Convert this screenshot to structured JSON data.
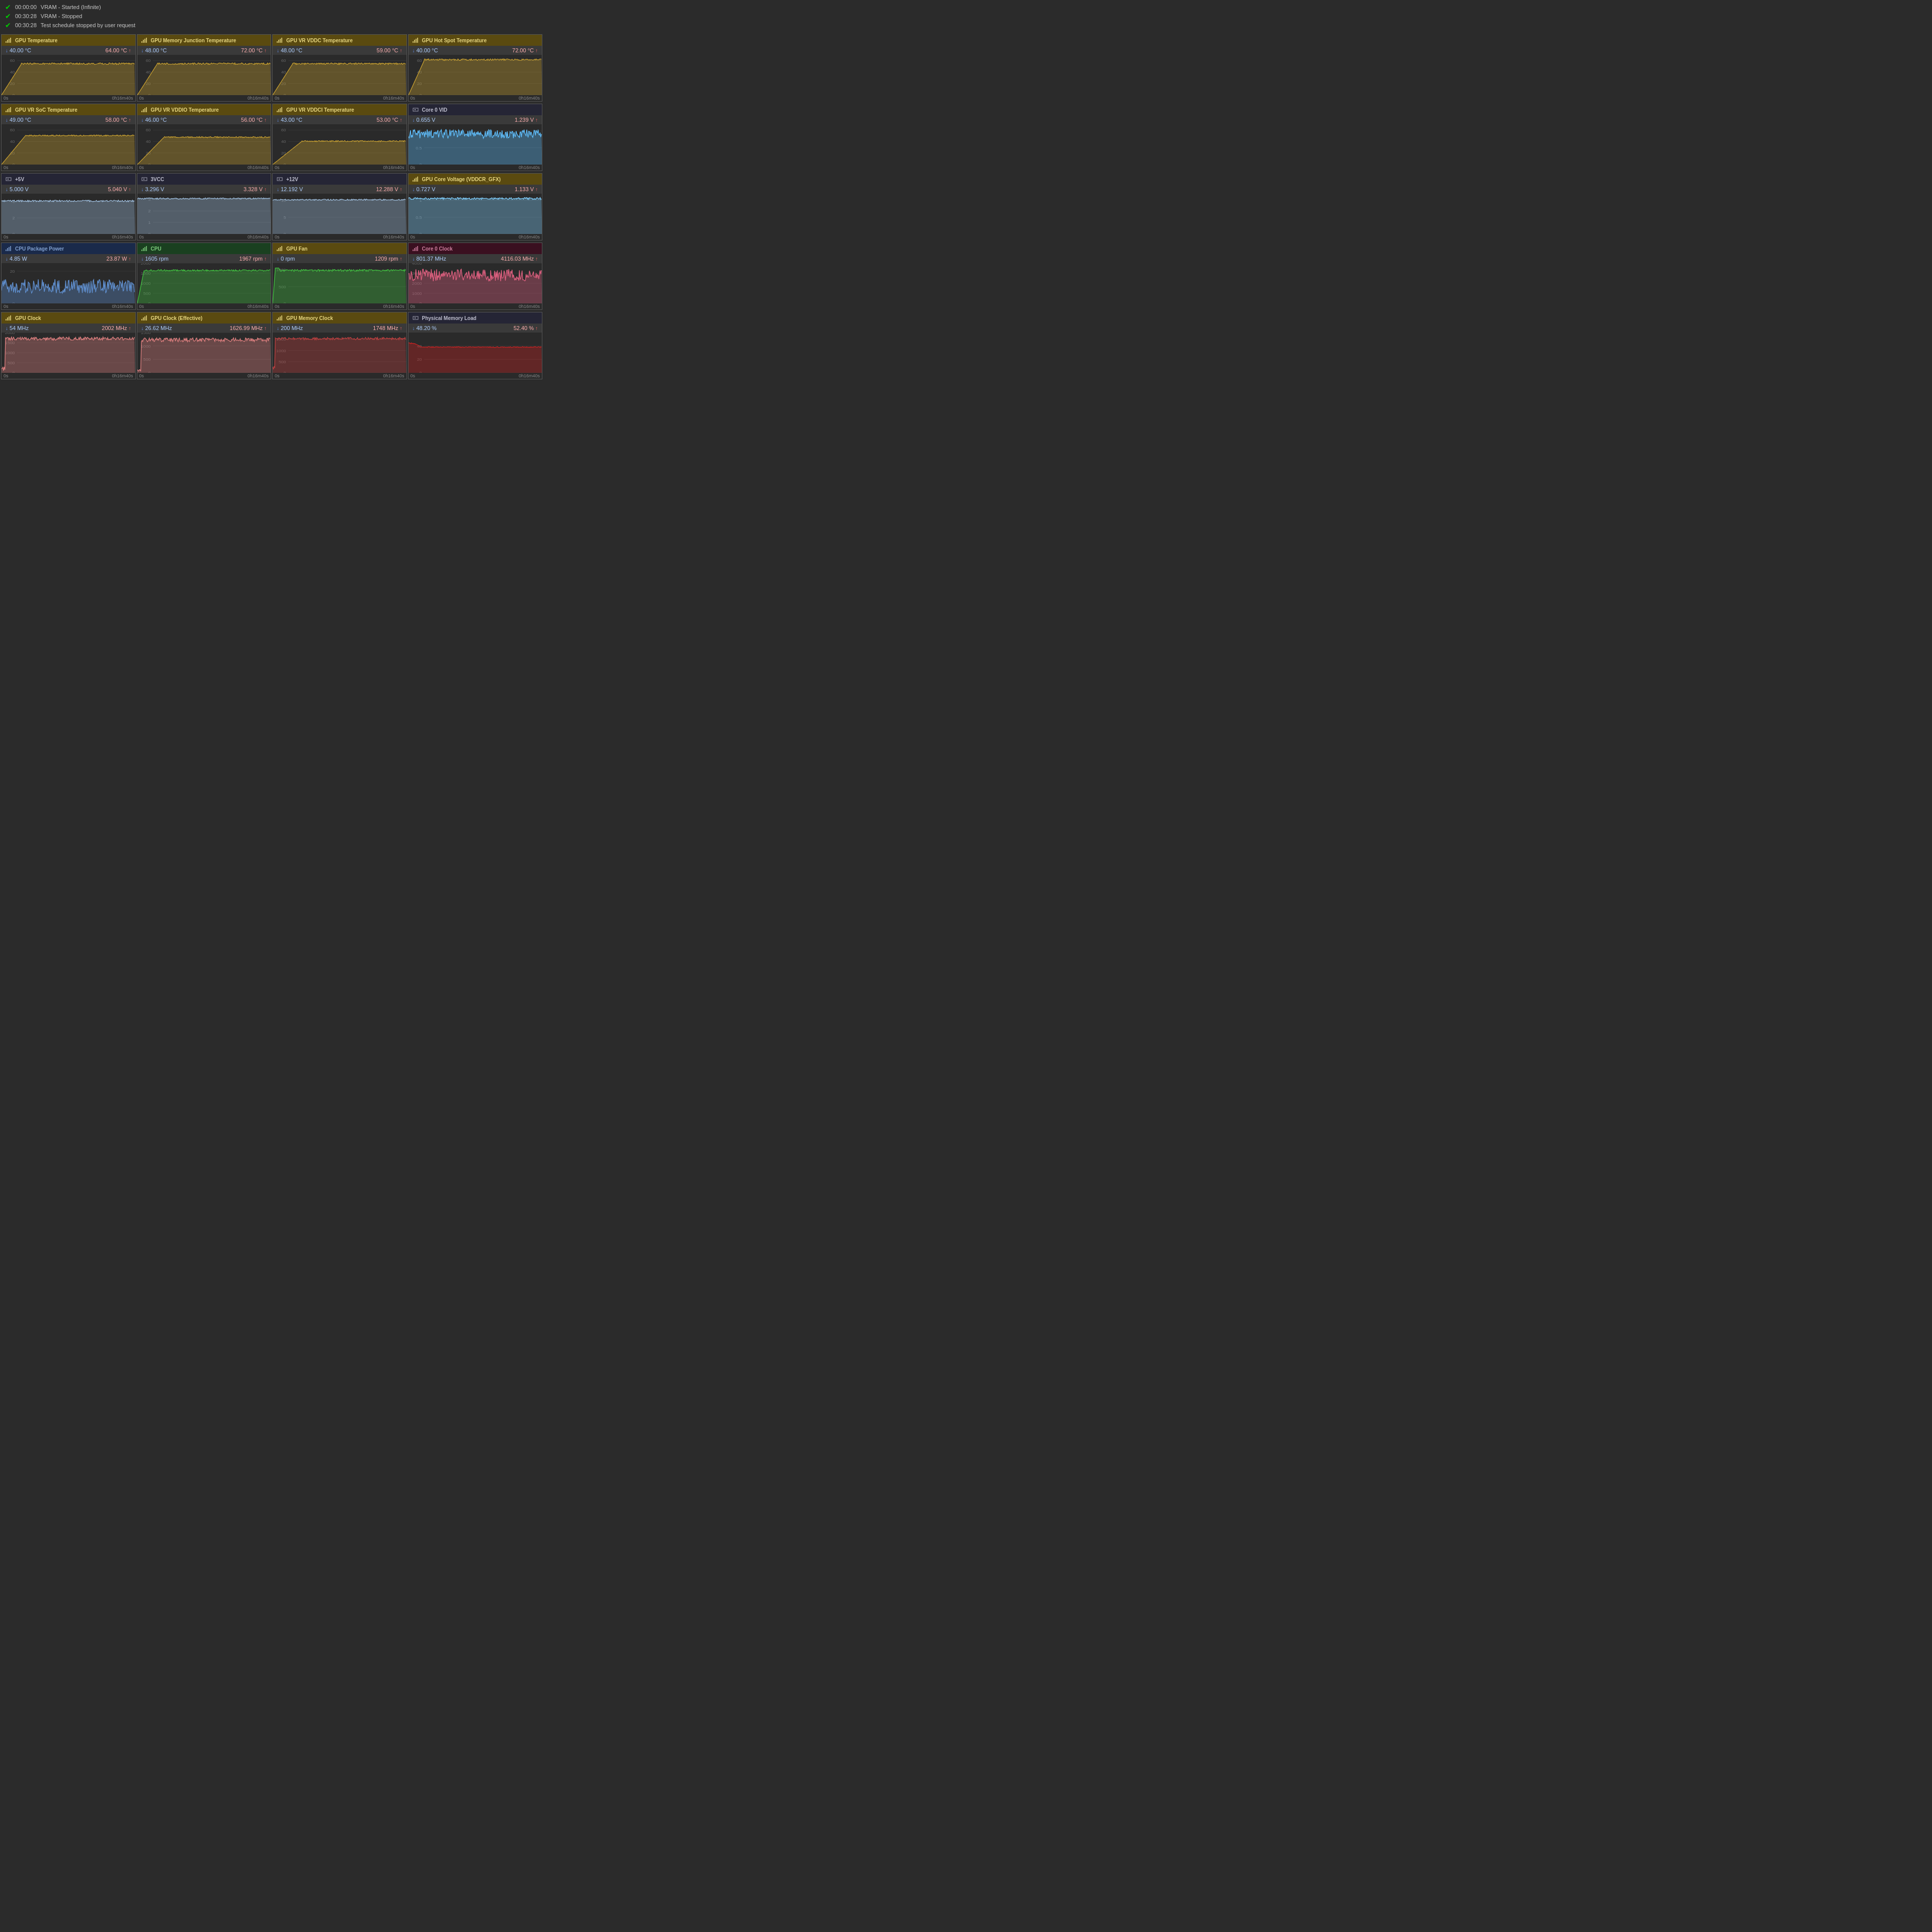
{
  "log": {
    "entries": [
      {
        "time": "00:00:00",
        "text": "VRAM - Started (Infinite)"
      },
      {
        "time": "00:30:28",
        "text": "VRAM - Stopped"
      },
      {
        "time": "00:30:28",
        "text": "Test schedule stopped by user request"
      }
    ]
  },
  "rows": [
    {
      "cards": [
        {
          "title": "GPU Temperature",
          "header_style": "gold",
          "icon": "📊",
          "min": "40.00 °C",
          "max": "64.00 °C",
          "chart_color": "#c8a030",
          "chart_type": "rise_flat",
          "y_max": 70,
          "y_ticks": [
            0,
            20,
            40,
            60
          ]
        },
        {
          "title": "GPU Memory Junction Temperature",
          "header_style": "gold",
          "icon": "📊",
          "min": "48.00 °C",
          "max": "72.00 °C",
          "chart_color": "#c8a030",
          "chart_type": "rise_flat",
          "y_max": 70,
          "y_ticks": [
            0,
            20,
            40,
            60
          ]
        },
        {
          "title": "GPU VR VDDC Temperature",
          "header_style": "gold",
          "icon": "📊",
          "min": "48.00 °C",
          "max": "59.00 °C",
          "chart_color": "#c8a030",
          "chart_type": "rise_flat",
          "y_max": 70,
          "y_ticks": [
            0,
            20,
            40,
            60
          ]
        },
        {
          "title": "GPU Hot Spot Temperature",
          "header_style": "gold",
          "icon": "📊",
          "min": "40.00 °C",
          "max": "72.00 °C",
          "chart_color": "#c8a030",
          "chart_type": "rise_flat_high",
          "y_max": 70,
          "y_ticks": [
            0,
            20,
            40,
            60
          ]
        }
      ]
    },
    {
      "cards": [
        {
          "title": "GPU VR SoC Temperature",
          "header_style": "gold",
          "icon": "📊",
          "min": "49.00 °C",
          "max": "58.00 °C",
          "chart_color": "#c8a030",
          "chart_type": "rise_flat_mid",
          "y_max": 70,
          "y_ticks": [
            0,
            20,
            40,
            60
          ]
        },
        {
          "title": "GPU VR VDDIO Temperature",
          "header_style": "gold",
          "icon": "📊",
          "min": "46.00 °C",
          "max": "56.00 °C",
          "chart_color": "#c8a030",
          "chart_type": "rise_flat_mid2",
          "y_max": 70,
          "y_ticks": [
            0,
            20,
            40,
            60
          ]
        },
        {
          "title": "GPU VR VDDCI Temperature",
          "header_style": "gold",
          "icon": "📊",
          "min": "43.00 °C",
          "max": "53.00 °C",
          "chart_color": "#c8a030",
          "chart_type": "rise_flat_low",
          "y_max": 70,
          "y_ticks": [
            0,
            20,
            40,
            60
          ]
        },
        {
          "title": "Core 0 VID",
          "header_style": "dark",
          "icon": "⬜",
          "min": "0.655 V",
          "max": "1.239 V",
          "chart_color": "#60c0ff",
          "chart_type": "vid_noisy",
          "y_max": 1.2,
          "y_ticks": [
            0,
            0.5,
            1
          ]
        }
      ]
    },
    {
      "cards": [
        {
          "title": "+5V",
          "header_style": "dark",
          "icon": "⬛",
          "min": "5.000 V",
          "max": "5.040 V",
          "chart_color": "#a0c0e0",
          "chart_type": "flat_noisy",
          "y_max": 5,
          "y_ticks": [
            0,
            2,
            4
          ]
        },
        {
          "title": "3VCC",
          "header_style": "dark",
          "icon": "⬛",
          "min": "3.296 V",
          "max": "3.328 V",
          "chart_color": "#a0c0e0",
          "chart_type": "flat_noisy_3v",
          "y_max": 3.5,
          "y_ticks": [
            0,
            1,
            2,
            3
          ]
        },
        {
          "title": "+12V",
          "header_style": "dark",
          "icon": "⬛",
          "min": "12.192 V",
          "max": "12.288 V",
          "chart_color": "#a0c0e0",
          "chart_type": "flat_noisy_12v",
          "y_max": 12,
          "y_ticks": [
            0,
            5,
            10
          ]
        },
        {
          "title": "GPU Core Voltage (VDDCR_GFX)",
          "header_style": "gold",
          "icon": "📊",
          "min": "0.727 V",
          "max": "1.133 V",
          "chart_color": "#80d0ff",
          "chart_type": "flat_top_noisy",
          "y_max": 1.2,
          "y_ticks": [
            0,
            0.5,
            1
          ]
        }
      ]
    },
    {
      "cards": [
        {
          "title": "CPU Package Power",
          "header_style": "blue",
          "icon": "⬜",
          "min": "4.85 W",
          "max": "23.87 W",
          "chart_color": "#6090d0",
          "chart_type": "cpu_power",
          "y_max": 25,
          "y_ticks": [
            0,
            10,
            20
          ]
        },
        {
          "title": "CPU",
          "header_style": "green",
          "icon": "⬛",
          "min": "1605 rpm",
          "max": "1967 rpm",
          "chart_color": "#40c040",
          "chart_type": "cpu_fan",
          "y_max": 2000,
          "y_ticks": [
            0,
            500,
            1000,
            1500,
            2000
          ]
        },
        {
          "title": "GPU Fan",
          "header_style": "gold",
          "icon": "📊",
          "min": "0 rpm",
          "max": "1209 rpm",
          "chart_color": "#40c040",
          "chart_type": "gpu_fan",
          "y_max": 1200,
          "y_ticks": [
            0,
            500,
            1000
          ]
        },
        {
          "title": "Core 0 Clock",
          "header_style": "purple",
          "icon": "⬜",
          "min": "801.37 MHz",
          "max": "4116.03 MHz",
          "chart_color": "#e06080",
          "chart_type": "core_clock",
          "y_max": 4000,
          "y_ticks": [
            0,
            1000,
            2000,
            3000,
            4000
          ]
        }
      ]
    },
    {
      "cards": [
        {
          "title": "GPU Clock",
          "header_style": "gold",
          "icon": "📊",
          "min": "54 MHz",
          "max": "2002 MHz",
          "chart_color": "#e08080",
          "chart_type": "gpu_clock",
          "y_max": 2000,
          "y_ticks": [
            0,
            500,
            1000,
            1500,
            2000
          ]
        },
        {
          "title": "GPU Clock (Effective)",
          "header_style": "gold",
          "icon": "📊",
          "min": "26.62 MHz",
          "max": "1626.99 MHz",
          "chart_color": "#e08080",
          "chart_type": "gpu_clock_eff",
          "y_max": 1500,
          "y_ticks": [
            0,
            500,
            1000,
            1500
          ]
        },
        {
          "title": "GPU Memory Clock",
          "header_style": "gold",
          "icon": "📊",
          "min": "200 MHz",
          "max": "1748 MHz",
          "chart_color": "#c04040",
          "chart_type": "gpu_mem_clock",
          "y_max": 1800,
          "y_ticks": [
            0,
            500,
            1000,
            1500
          ]
        },
        {
          "title": "Physical Memory Load",
          "header_style": "dark",
          "icon": "?",
          "min": "48.20 %",
          "max": "52.40 %",
          "chart_color": "#cc2222",
          "chart_type": "mem_load",
          "y_max": 60,
          "y_ticks": [
            0,
            20,
            40
          ]
        }
      ]
    }
  ],
  "time_label": "0h16m40s",
  "time_start": "0s",
  "colors": {
    "gold_header": "#5a4a10",
    "green_header": "#1a4020",
    "blue_header": "#1a2a4a",
    "purple_header": "#3a1020",
    "dark_header": "#252535"
  }
}
